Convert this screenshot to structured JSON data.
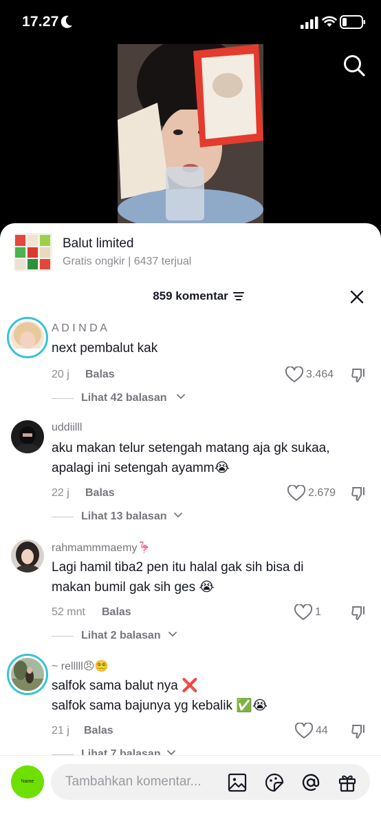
{
  "status_bar": {
    "time": "17.27"
  },
  "product": {
    "name": "Balut limited",
    "subtitle": "Gratis ongkir | 6437 terjual"
  },
  "comments_header": {
    "count_label": "859 komentar"
  },
  "comments": [
    {
      "username": "A D I N D A",
      "text_lines": [
        "next pembalut kak"
      ],
      "time": "20 j",
      "reply_label": "Balas",
      "likes": "3.464",
      "replies_label": "Lihat 42 balasan"
    },
    {
      "username": "uddiilll",
      "text_lines": [
        "aku makan telur setengah matang aja gk sukaa,",
        "apalagi ini setengah ayamm😭"
      ],
      "time": "22 j",
      "reply_label": "Balas",
      "likes": "2.679",
      "replies_label": "Lihat 13 balasan"
    },
    {
      "username": "rahmammmaemy🦩",
      "text_lines": [
        "Lagi hamil tiba2 pen itu halal gak sih bisa di",
        "makan bumil gak sih ges 😭"
      ],
      "time": "52 mnt",
      "reply_label": "Balas",
      "likes": "1",
      "replies_label": "Lihat 2 balasan"
    },
    {
      "username": "~ relllll😠😵‍💫",
      "text_lines": [
        "salfok sama balut nya ❌",
        "salfok sama bajunya yg kebalik ✅😭"
      ],
      "time": "21 j",
      "reply_label": "Balas",
      "likes": "44",
      "replies_label": "Lihat 7 balasan"
    }
  ],
  "bottom_bar": {
    "avatar_text": "Name",
    "placeholder": "Tambahkan komentar..."
  },
  "icons": {
    "search": "search-icon",
    "close": "close-icon",
    "filter": "filter-icon",
    "like": "heart-icon",
    "dislike": "thumbs-down-icon",
    "image": "image-icon",
    "sticker": "sticker-icon",
    "mention": "at-icon",
    "gift": "gift-icon"
  },
  "colors": {
    "accent_ring": "#35c3d6",
    "my_avatar": "#6ee000"
  }
}
